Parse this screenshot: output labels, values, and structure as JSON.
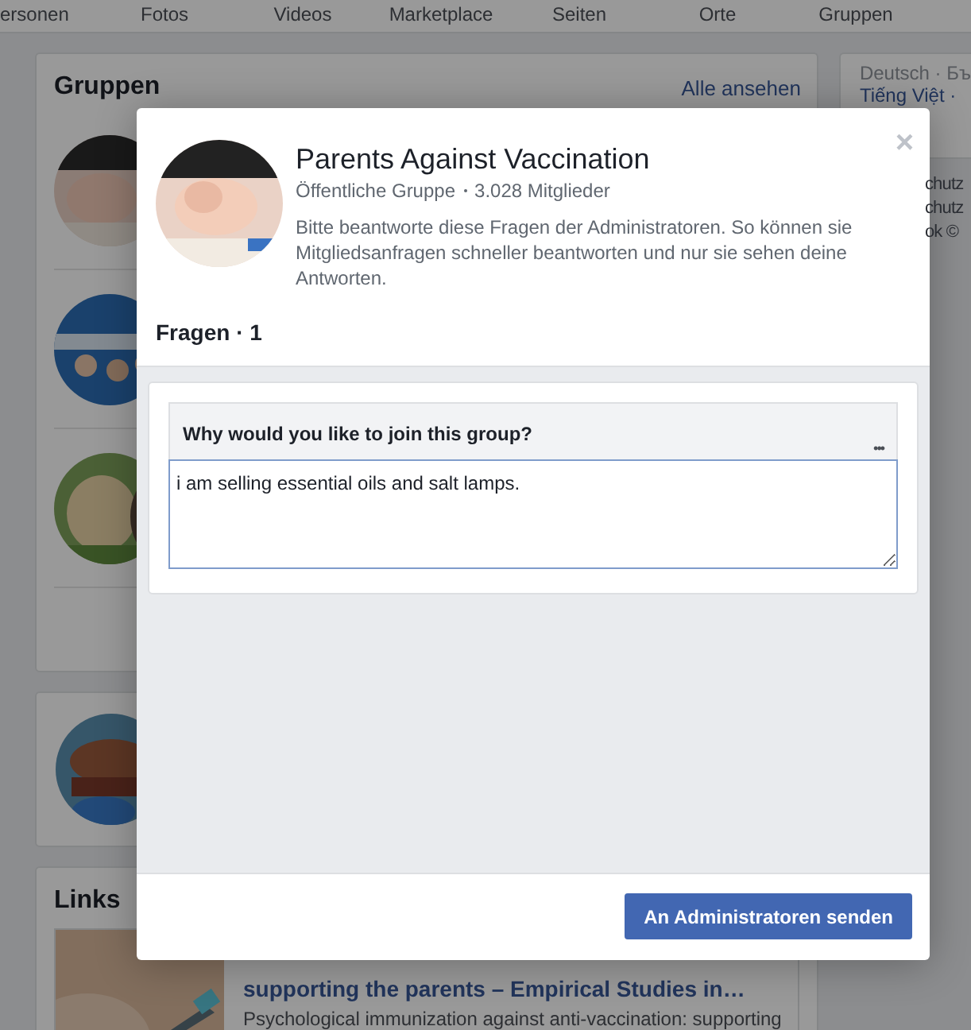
{
  "nav": {
    "tabs": [
      "ersonen",
      "Fotos",
      "Videos",
      "Marketplace",
      "Seiten",
      "Orte",
      "Gruppen"
    ]
  },
  "groups_card": {
    "title": "Gruppen",
    "see_all": "Alle ansehen"
  },
  "links_card": {
    "title": "Links",
    "link_title": "supporting the parents – Empirical Studies in…",
    "link_description": "Psychological immunization against anti-vaccination: supporting"
  },
  "right_column": {
    "languages": [
      "Deutsch · Бъ",
      "Tiếng Việt ·"
    ],
    "footer_lines": [
      "chutz",
      "chutz",
      "ok ©"
    ]
  },
  "dialog": {
    "title": "Parents Against Vaccination",
    "privacy": "Öffentliche Gruppe",
    "members": "3.028 Mitglieder",
    "instructions": "Bitte beantworte diese Fragen der Administratoren. So können sie Mitgliedsanfragen schneller beantworten und nur sie sehen deine Antworten.",
    "close": "×",
    "questions_heading": "Fragen · 1",
    "questions": [
      {
        "question": "Why would you like to join this group?",
        "more": "•••",
        "answer": "i am selling essential oils and salt lamps."
      }
    ],
    "submit": "An Administratoren senden"
  }
}
